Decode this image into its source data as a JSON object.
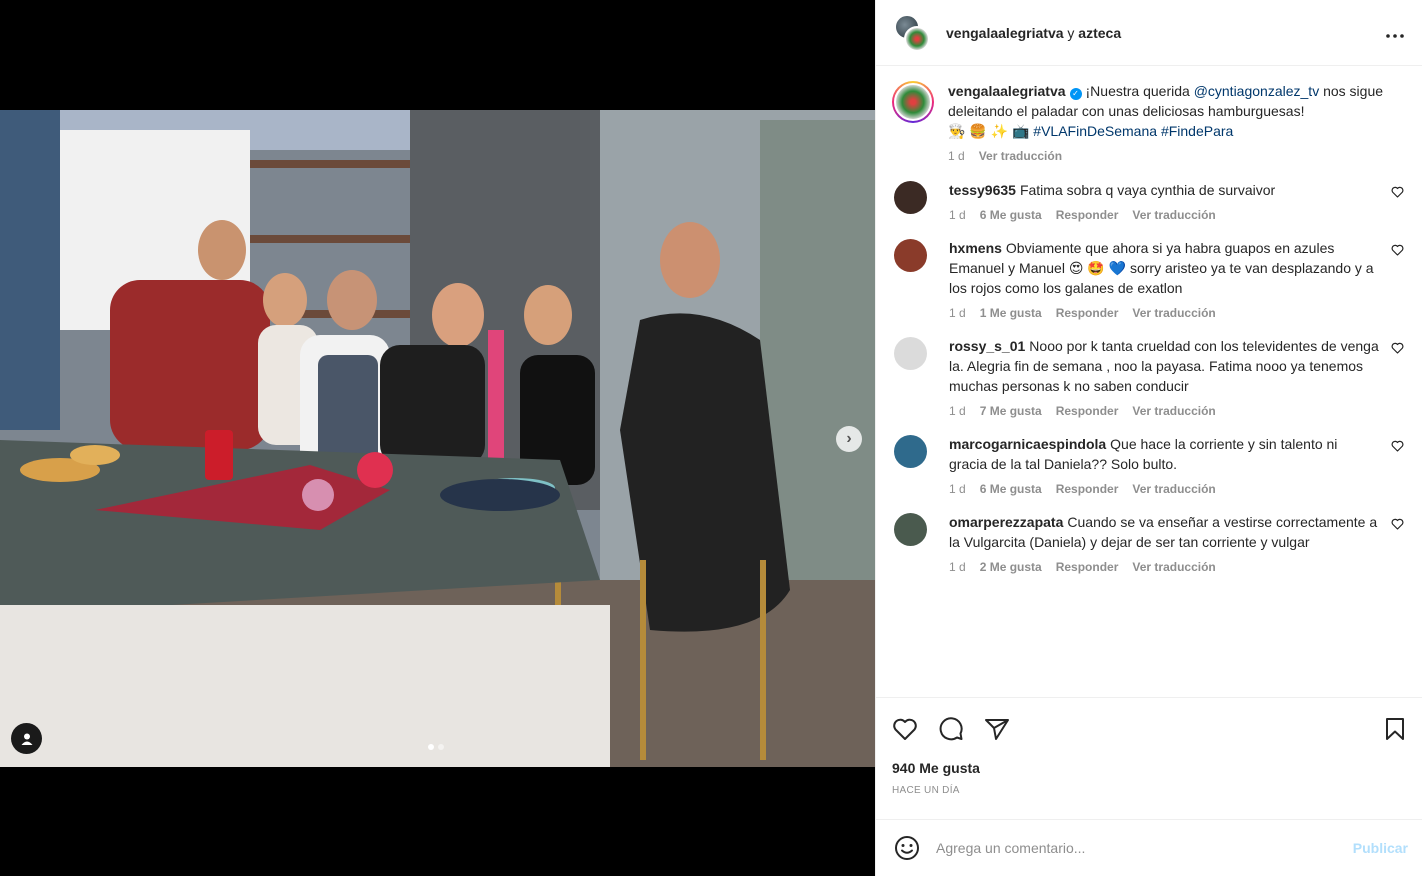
{
  "header": {
    "user1": "vengalaalegriatva",
    "separator": "y",
    "user2": "azteca",
    "more_icon": "more-horizontal-icon"
  },
  "media": {
    "next_icon": "›",
    "slides_total": 2,
    "slide_active": 1
  },
  "caption": {
    "user": "vengalaalegriatva",
    "verified_glyph": "✓",
    "text_before": "¡Nuestra querida ",
    "mention": "@cyntiagonzalez_tv",
    "text_after": " nos sigue deleitando el paladar con unas deliciosas hamburguesas!",
    "emojis": "👨‍🍳 🍔 ✨ 📺",
    "tag1": "#VLAFinDeSemana",
    "tag2": "#FindePara",
    "time": "1 d",
    "translate": "Ver traducción"
  },
  "comments": [
    {
      "user": "tessy9635",
      "text": "Fatima sobra q vaya cynthia de survaivor",
      "time": "1 d",
      "likes": "6 Me gusta",
      "reply": "Responder",
      "translate": "Ver traducción",
      "avatar_color": "#3b2a24"
    },
    {
      "user": "hxmens",
      "text": "Obviamente que ahora si ya habra guapos en azules Emanuel y Manuel 😍 🤩 💙 sorry aristeo ya te van desplazando y a los rojos como los galanes de exatlon",
      "time": "1 d",
      "likes": "1 Me gusta",
      "reply": "Responder",
      "translate": "Ver traducción",
      "avatar_color": "#8a3b2a"
    },
    {
      "user": "rossy_s_01",
      "text": "Nooo por k tanta crueldad con los televidentes de venga la. Alegria fin de semana , noo la payasa. Fatima nooo ya tenemos muchas personas k no saben conducir",
      "time": "1 d",
      "likes": "7 Me gusta",
      "reply": "Responder",
      "translate": "Ver traducción",
      "avatar_color": "#dbdbdb"
    },
    {
      "user": "marcogarnicaespindola",
      "text": "Que hace la corriente y sin talento ni gracia de la tal Daniela?? Solo bulto.",
      "time": "1 d",
      "likes": "6 Me gusta",
      "reply": "Responder",
      "translate": "Ver traducción",
      "avatar_color": "#2f6a8c"
    },
    {
      "user": "omarperezzapata",
      "text": "Cuando se va enseñar a vestirse correctamente a la Vulgarcita (Daniela) y dejar de ser tan corriente y vulgar",
      "time": "1 d",
      "likes": "2 Me gusta",
      "reply": "Responder",
      "translate": "Ver traducción",
      "avatar_color": "#4a5a4e"
    }
  ],
  "actions": {
    "like_icon": "heart-icon",
    "comment_icon": "comment-icon",
    "share_icon": "send-icon",
    "save_icon": "bookmark-icon",
    "likes_count": "940 Me gusta",
    "posted": "HACE UN DÍA"
  },
  "add_comment": {
    "emoji_icon": "smiley-icon",
    "placeholder": "Agrega un comentario...",
    "publish": "Publicar"
  },
  "colors": {
    "accent": "#0095f6",
    "publish_disabled": "#b2dffc",
    "link": "#00376b",
    "secondary_text": "#8e8e8e"
  }
}
